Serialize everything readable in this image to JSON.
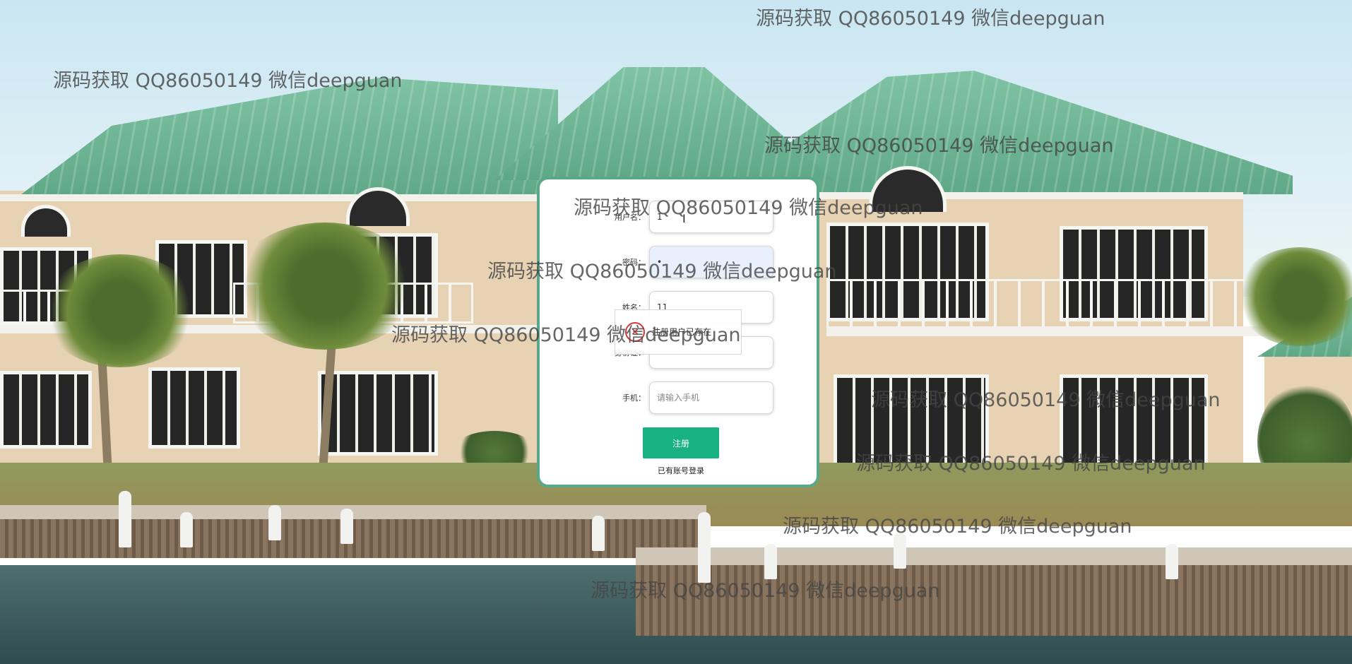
{
  "form": {
    "username": {
      "label": "用户名：",
      "value": "1"
    },
    "password": {
      "label": "密码：",
      "value": "•"
    },
    "name": {
      "label": "姓名：",
      "value": "11"
    },
    "id_card": {
      "label": "身份证：",
      "value": ""
    },
    "phone": {
      "label": "手机：",
      "value": "",
      "placeholder": "请输入手机"
    },
    "submit_label": "注册",
    "login_link": "已有账号登录"
  },
  "toast": {
    "icon": "error-icon",
    "glyph": "×",
    "text": "注册用户已存在"
  },
  "watermark": {
    "text": "源码获取 QQ86050149 微信deepguan"
  },
  "colors": {
    "accent": "#17b182",
    "card_border": "#59a88a",
    "roof": "#6fb695"
  }
}
